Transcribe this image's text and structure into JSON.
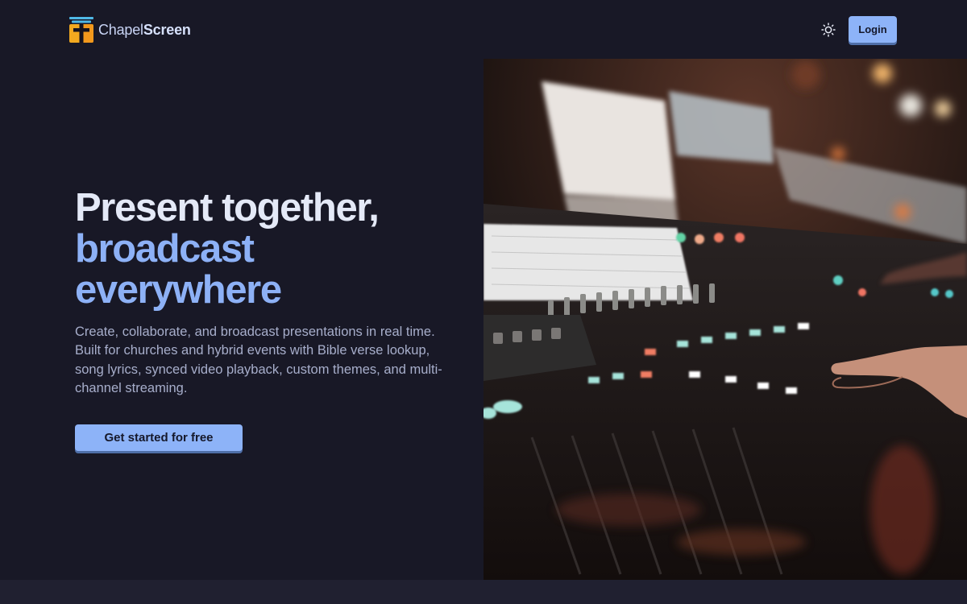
{
  "brand": {
    "name_light": "Chapel",
    "name_bold": "Screen",
    "logo_icon": "cross-screen-logo-icon",
    "logo_colors": [
      "#4fb8e6",
      "#f2a91f",
      "#f28a1a"
    ]
  },
  "header": {
    "theme_toggle_icon": "sun-icon",
    "login_label": "Login"
  },
  "hero": {
    "title_line1": "Present together,",
    "title_line2": "broadcast",
    "title_line3": "everywhere",
    "description": "Create, collaborate, and broadcast presentations in real time. Built for churches and hybrid events with Bible verse lookup, song lyrics, synced video playback, custom themes, and multi-channel streaming.",
    "cta_label": "Get started for free",
    "image_subject": "audio-mixing-console-photo"
  },
  "colors": {
    "background": "#181826",
    "accent": "#8db3f8",
    "title_text": "#e4e9f7",
    "title_accent": "#8db1f6",
    "body_text": "#a7aecb"
  }
}
